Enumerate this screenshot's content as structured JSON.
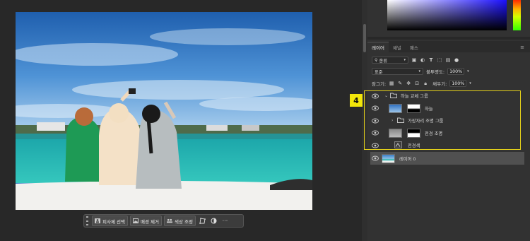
{
  "canvas": {
    "image_description_icon": "photo-canvas"
  },
  "context_bar": {
    "subject_select": "피사체 선택",
    "remove_background": "배경 제거",
    "color_adjust": "색상 조정",
    "more": "···"
  },
  "panel": {
    "tabs": [
      {
        "label": "레이어",
        "active": true
      },
      {
        "label": "채널",
        "active": false
      },
      {
        "label": "패스",
        "active": false
      }
    ],
    "filter": {
      "kind_label": "종류"
    },
    "blend_mode": "표준",
    "opacity_label": "불투명도:",
    "opacity_value": "100%",
    "lock_label": "잠그기:",
    "fill_label": "채우기:",
    "fill_value": "100%",
    "layers": [
      {
        "name": "하늘 교체 그룹",
        "type": "group"
      },
      {
        "name": "하늘",
        "type": "layer"
      },
      {
        "name": "가장자리 조명 그룹",
        "type": "group"
      },
      {
        "name": "전경 조명",
        "type": "layer"
      },
      {
        "name": "전경색",
        "type": "fill"
      },
      {
        "name": "레이어 0",
        "type": "layer"
      }
    ]
  },
  "annotation": {
    "badge": "4",
    "badge_color": "#f2e60a",
    "box_color": "#e6d21a"
  }
}
